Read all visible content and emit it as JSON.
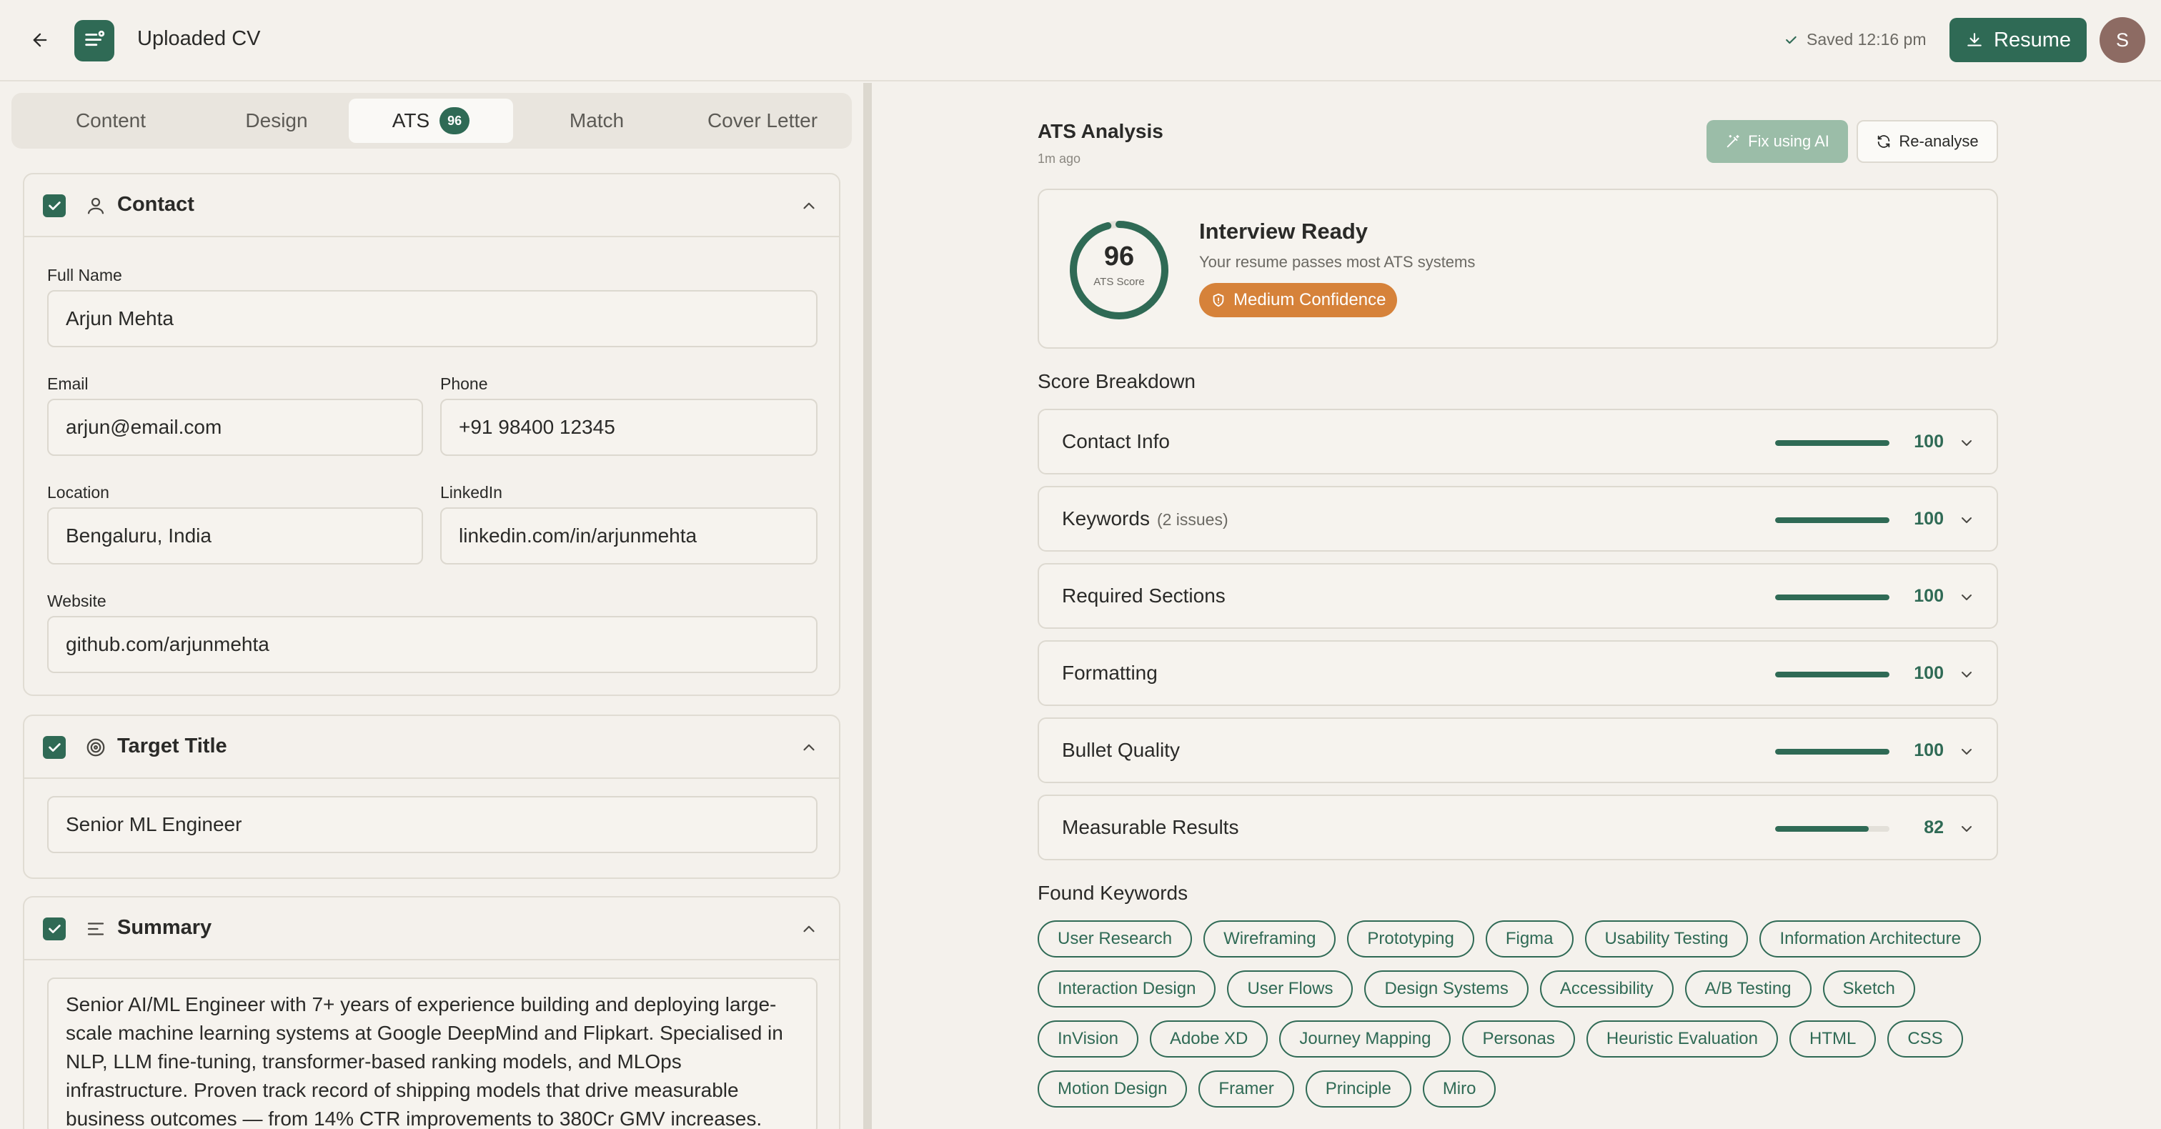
{
  "header": {
    "doc_title": "Uploaded CV",
    "saved_text": "Saved 12:16 pm",
    "resume_button": "Resume",
    "avatar_initial": "S"
  },
  "tabs": [
    {
      "label": "Content"
    },
    {
      "label": "Design"
    },
    {
      "label": "ATS",
      "badge": "96"
    },
    {
      "label": "Match"
    },
    {
      "label": "Cover Letter"
    }
  ],
  "contact": {
    "title": "Contact",
    "full_name_label": "Full Name",
    "full_name": "Arjun Mehta",
    "email_label": "Email",
    "email": "arjun@email.com",
    "phone_label": "Phone",
    "phone": "+91 98400 12345",
    "location_label": "Location",
    "location": "Bengaluru, India",
    "linkedin_label": "LinkedIn",
    "linkedin": "linkedin.com/in/arjunmehta",
    "website_label": "Website",
    "website": "github.com/arjunmehta"
  },
  "target": {
    "title": "Target Title",
    "value": "Senior ML Engineer"
  },
  "summary": {
    "title": "Summary",
    "text": "Senior AI/ML Engineer with 7+ years of experience building and deploying large-scale machine learning systems at Google DeepMind and Flipkart. Specialised in NLP, LLM fine-tuning, transformer-based ranking models, and MLOps infrastructure. Proven track record of shipping models that drive measurable business outcomes — from 14% CTR improvements to 380Cr GMV increases."
  },
  "ats": {
    "title": "ATS Analysis",
    "subtitle": "1m ago",
    "fix_button": "Fix using AI",
    "reanalyse_button": "Re-analyse",
    "score": 96,
    "score_label": "ATS Score",
    "status_title": "Interview Ready",
    "status_sub": "Your resume passes most ATS systems",
    "confidence": "Medium Confidence",
    "breakdown_title": "Score Breakdown",
    "breakdown": [
      {
        "label": "Contact Info",
        "issues": "",
        "value": 100
      },
      {
        "label": "Keywords",
        "issues": "(2 issues)",
        "value": 100
      },
      {
        "label": "Required Sections",
        "issues": "",
        "value": 100
      },
      {
        "label": "Formatting",
        "issues": "",
        "value": 100
      },
      {
        "label": "Bullet Quality",
        "issues": "",
        "value": 100
      },
      {
        "label": "Measurable Results",
        "issues": "",
        "value": 82
      }
    ],
    "keywords_title": "Found Keywords",
    "keywords": [
      [
        "User Research",
        "Wireframing",
        "Prototyping",
        "Figma",
        "Usability Testing",
        "Information Architecture"
      ],
      [
        "Interaction Design",
        "User Flows",
        "Design Systems",
        "Accessibility",
        "A/B Testing",
        "Sketch"
      ],
      [
        "InVision",
        "Adobe XD",
        "Journey Mapping",
        "Personas",
        "Heuristic Evaluation",
        "HTML",
        "CSS"
      ],
      [
        "Motion Design",
        "Framer",
        "Principle",
        "Miro"
      ]
    ]
  },
  "colors": {
    "accent": "#2f6a55",
    "confidence": "#d6823a",
    "background": "#f4f1ec"
  }
}
